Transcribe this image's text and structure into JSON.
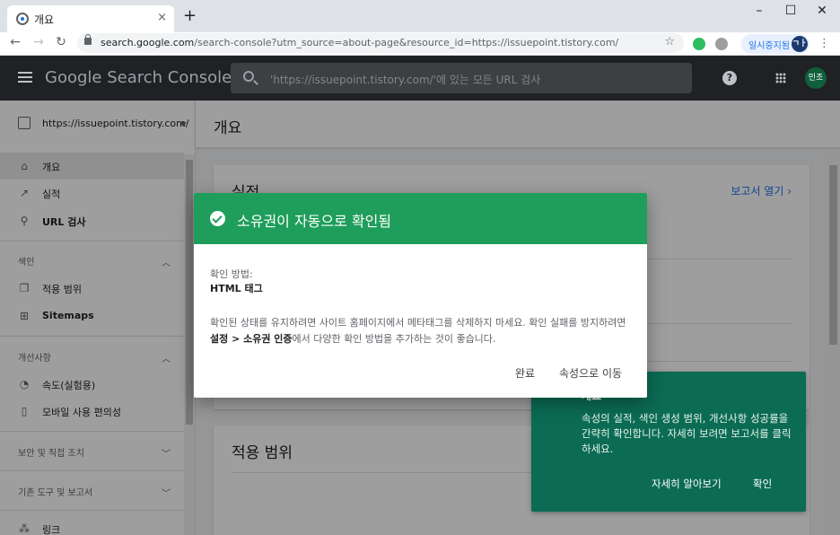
{
  "browser": {
    "tab_title": "개요",
    "tab_close": "×",
    "new_tab": "+",
    "minimize": "–",
    "maximize": "☐",
    "close": "✕",
    "back": "←",
    "forward": "→",
    "reload": "↻",
    "url_host": "search.google.com",
    "url_rest": "/search-console?utm_source=about-page&resource_id=https://issuepoint.tistory.com/",
    "bookmark_star": "☆",
    "profile_label": "일시중지됨",
    "profile_avatar": "ㄱㅏ",
    "menu": "⋮"
  },
  "header": {
    "brand": "Google Search Console",
    "search_placeholder": "'https://issuepoint.tistory.com/'에 있는 모든 URL 검사",
    "help": "?",
    "avatar": "민조"
  },
  "sidebar": {
    "property": "https://issuepoint.tistory.com/",
    "items": [
      {
        "label": "개요",
        "icon": "home-icon",
        "glyph": "⌂"
      },
      {
        "label": "실적",
        "icon": "trend-icon",
        "glyph": "↗"
      },
      {
        "label": "URL 검사",
        "icon": "search-icon",
        "glyph": "⚲"
      }
    ],
    "index_section": "색인",
    "index_items": [
      {
        "label": "적용 범위",
        "icon": "copy-icon",
        "glyph": "❐"
      },
      {
        "label": "Sitemaps",
        "icon": "sitemap-icon",
        "glyph": "⊞"
      }
    ],
    "enhance_section": "개선사항",
    "enhance_items": [
      {
        "label": "속도(실험용)",
        "icon": "speed-icon",
        "glyph": "◔"
      },
      {
        "label": "모바일 사용 편의성",
        "icon": "mobile-icon",
        "glyph": "▯"
      }
    ],
    "security_section": "보안 및 직접 조치",
    "legacy_section": "기존 도구 및 보고서",
    "links_item": {
      "label": "링크",
      "icon": "links-icon",
      "glyph": "⁂"
    }
  },
  "main": {
    "title": "개요",
    "card1_title": "실적",
    "card1_link": "보고서 열기",
    "card2_title": "적용 범위"
  },
  "tooltip": {
    "title": "개요",
    "body": "속성의 실적, 색인 생성 범위, 개선사항 성공률을 간략히 확인합니다. 자세히 보려면 보고서를 클릭하세요.",
    "learn_more": "자세히 알아보기",
    "confirm": "확인"
  },
  "dialog": {
    "title": "소유권이 자동으로 확인됨",
    "method_label": "확인 방법:",
    "method_value": "HTML 태그",
    "body_1": "확인된 상태를 유지하려면 사이트 홈페이지에서 메타태그를 삭제하지 마세요. 확인 실패를 방지하려면 ",
    "body_bold": "설정 > 소유권 인증",
    "body_2": "에서 다양한 확인 방법을 추가하는 것이 좋습니다.",
    "done": "완료",
    "go_property": "속성으로 이동"
  }
}
